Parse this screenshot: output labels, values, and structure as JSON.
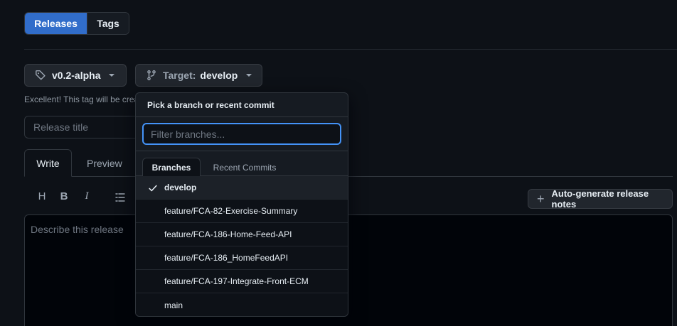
{
  "tabs": {
    "releases": "Releases",
    "tags": "Tags"
  },
  "tag_button": {
    "label": "v0.2-alpha"
  },
  "target_button": {
    "label": "Target:",
    "value": "develop"
  },
  "hint_text": "Excellent! This tag will be created from the target when you publish this release.",
  "release_title": {
    "placeholder": "Release title",
    "value": ""
  },
  "editor_tabs": {
    "write": "Write",
    "preview": "Preview"
  },
  "toolbar": {
    "heading": "H",
    "bold": "B",
    "italic": "I"
  },
  "autogen_button": {
    "label": "Auto-generate release notes"
  },
  "editor": {
    "placeholder": "Describe this release"
  },
  "dropdown": {
    "header": "Pick a branch or recent commit",
    "filter_placeholder": "Filter branches...",
    "tabs": {
      "branches": "Branches",
      "recent_commits": "Recent Commits"
    },
    "branches": [
      {
        "name": "develop",
        "selected": true
      },
      {
        "name": "feature/FCA-82-Exercise-Summary",
        "selected": false
      },
      {
        "name": "feature/FCA-186-Home-Feed-API",
        "selected": false
      },
      {
        "name": "feature/FCA-186_HomeFeedAPI",
        "selected": false
      },
      {
        "name": "feature/FCA-197-Integrate-Front-ECM",
        "selected": false
      },
      {
        "name": "main",
        "selected": false
      }
    ]
  },
  "colors": {
    "accent": "#316dca",
    "focus": "#4493f8",
    "background": "#0d1117"
  }
}
